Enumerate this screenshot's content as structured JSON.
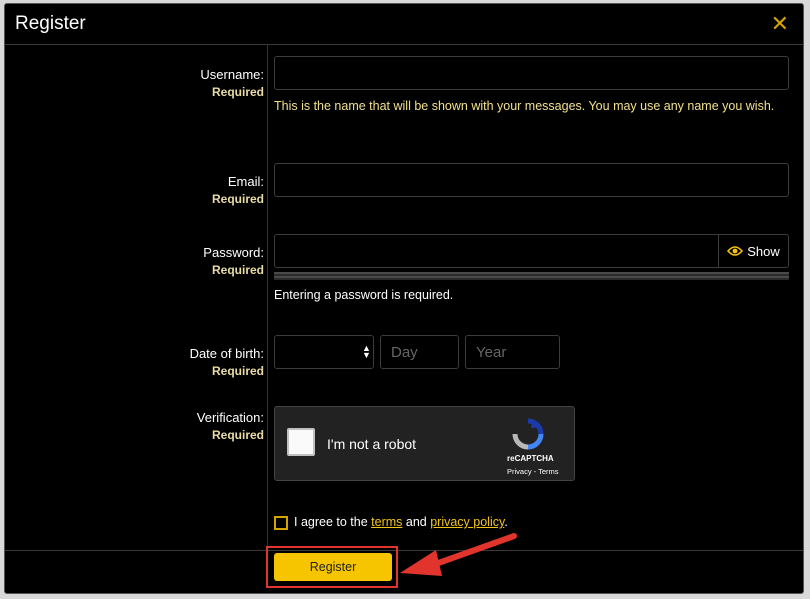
{
  "dialog": {
    "title": "Register",
    "close_icon": "close-icon"
  },
  "username": {
    "label": "Username:",
    "required": "Required",
    "value": "",
    "hint": "This is the name that will be shown with your messages. You may use any name you wish."
  },
  "email": {
    "label": "Email:",
    "required": "Required",
    "value": ""
  },
  "password": {
    "label": "Password:",
    "required": "Required",
    "value": "",
    "show_label": "Show",
    "show_icon": "eye-icon",
    "hint": "Entering a password is required."
  },
  "dob": {
    "label": "Date of birth:",
    "required": "Required",
    "month_value": "",
    "day_placeholder": "Day",
    "year_placeholder": "Year"
  },
  "verification": {
    "label": "Verification:",
    "required": "Required",
    "checkbox_text": "I'm not a robot",
    "brand": "reCAPTCHA",
    "privacy": "Privacy",
    "separator": " - ",
    "terms": "Terms"
  },
  "agreement": {
    "prefix": "I agree to the ",
    "terms_link": "terms",
    "middle": " and ",
    "privacy_link": "privacy policy",
    "suffix": "."
  },
  "submit": {
    "label": "Register"
  },
  "colors": {
    "accent": "#f6c500",
    "highlight": "#e0342d",
    "hint_text": "#f1e08a"
  }
}
